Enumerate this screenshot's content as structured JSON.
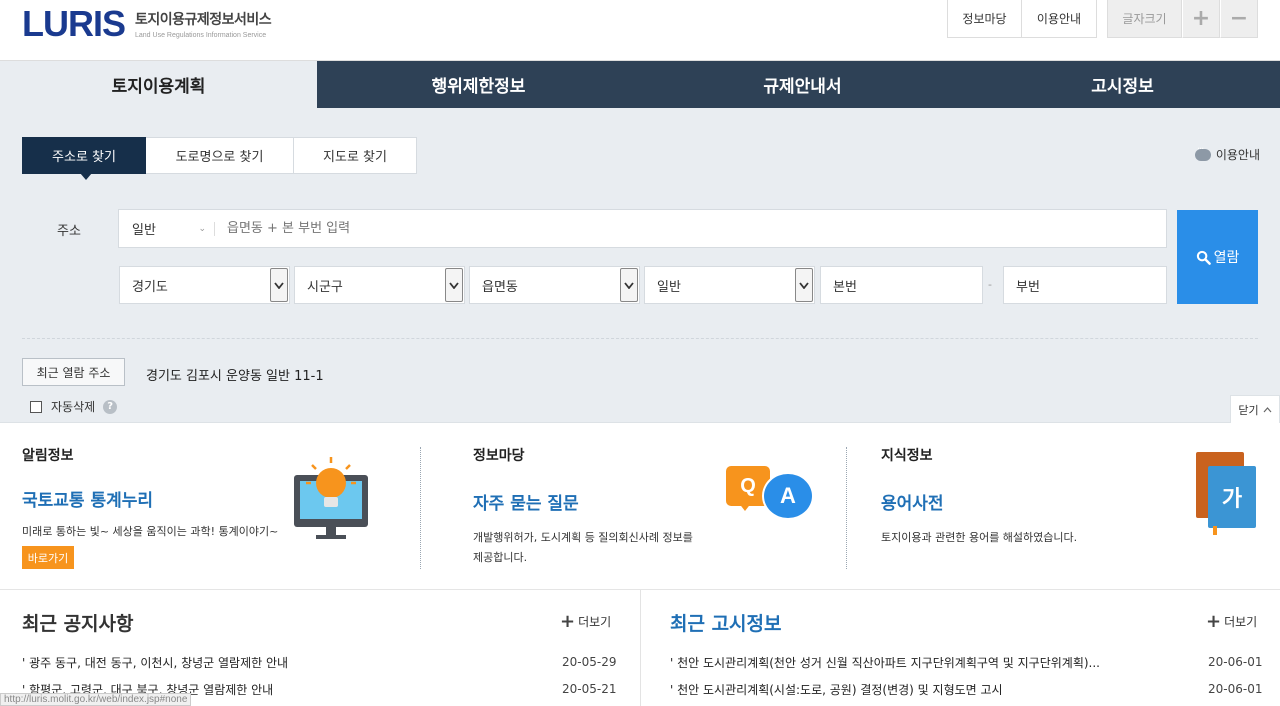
{
  "header": {
    "logo_text": "LURIS",
    "logo_title": "토지이용규제정보서비스",
    "logo_subtitle": "Land Use Regulations Information Service",
    "links": [
      "정보마당",
      "이용안내"
    ],
    "font_size_label": "글자크기",
    "font_plus": "+",
    "font_minus": "−"
  },
  "main_tabs": [
    "토지이용계획",
    "행위제한정보",
    "규제안내서",
    "고시정보"
  ],
  "search": {
    "tabs": [
      "주소로 찾기",
      "도로명으로 찾기",
      "지도로 찾기"
    ],
    "usage_guide": "이용안내",
    "address_label": "주소",
    "address_type": "일반",
    "address_placeholder": "읍면동 + 본 부번 입력",
    "selects": [
      "경기도",
      "시군구",
      "읍면동",
      "일반"
    ],
    "main_no_placeholder": "본번",
    "sub_no_placeholder": "부번",
    "dash": "-",
    "view_button": "열람",
    "recent_button": "최근 열람 주소",
    "recent_address": "경기도 김포시 운양동 일반 11-1",
    "auto_delete": "자동삭제",
    "help": "?",
    "close": "닫기"
  },
  "info": [
    {
      "title": "알림정보",
      "head": "국토교통 통계누리",
      "desc": "미래로 통하는 빛~ 세상을 움직이는 과학! 통계이야기~",
      "button": "바로가기"
    },
    {
      "title": "정보마당",
      "head": "자주 묻는 질문",
      "desc_line1": "개발행위허가, 도시계획 등 질의회신사례 정보를",
      "desc_line2": "제공합니다.",
      "qa_q": "Q",
      "qa_a": "A"
    },
    {
      "title": "지식정보",
      "head": "용어사전",
      "desc": "토지이용과 관련한 용어를 해설하였습니다.",
      "book_char": "가"
    }
  ],
  "notices": {
    "left_title": "최근 공지사항",
    "right_title": "최근 고시정보",
    "more": "더보기",
    "left_items": [
      {
        "text": "' 광주 동구, 대전 동구, 이천시, 창녕군 열람제한 안내",
        "date": "20-05-29"
      },
      {
        "text": "' 함평군, 고령군, 대구 북구, 창녕군 열람제한 안내",
        "date": "20-05-21"
      }
    ],
    "right_items": [
      {
        "text": "' 천안 도시관리계획(천안 성거 신월 직산아파트 지구단위계획구역 및 지구단위계획)...",
        "date": "20-06-01"
      },
      {
        "text": "' 천안 도시관리계획(시설:도로, 공원) 결정(변경) 및 지형도면 고시",
        "date": "20-06-01"
      }
    ]
  },
  "status_url": "http://luris.molit.go.kr/web/index.jsp#none",
  "colors": {
    "nav_dark": "#2e4156",
    "search_bg": "#e9edf1",
    "accent_blue": "#2a8ee8",
    "heading_blue": "#1f6fb5",
    "orange": "#f7941d"
  }
}
